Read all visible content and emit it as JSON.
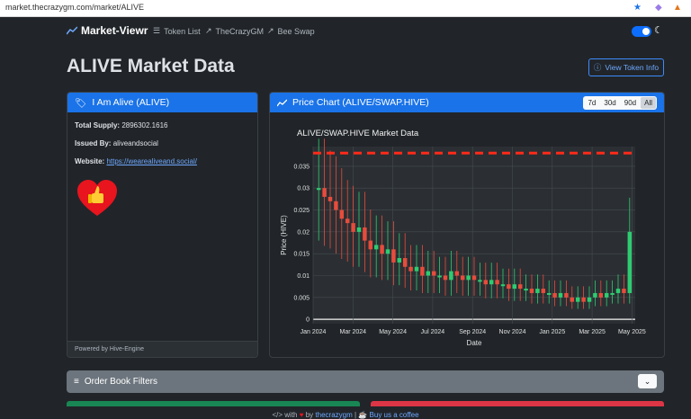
{
  "browser": {
    "url": "market.thecrazygm.com/market/ALIVE"
  },
  "nav": {
    "brand": "Market-Viewr",
    "links": [
      "Token List",
      "TheCrazyGM",
      "Bee Swap"
    ]
  },
  "page": {
    "title": "ALIVE Market Data",
    "view_token_info": "View Token Info"
  },
  "token_card": {
    "header": "I Am Alive (ALIVE)",
    "total_supply_label": "Total Supply:",
    "total_supply": "2896302.1616",
    "issued_by_label": "Issued By:",
    "issued_by": "aliveandsocial",
    "website_label": "Website:",
    "website": "https://wearealiveand.social/",
    "footer": "Powered by Hive-Engine"
  },
  "price_card": {
    "header": "Price Chart (ALIVE/SWAP.HIVE)",
    "ranges": [
      "7d",
      "30d",
      "90d",
      "All"
    ],
    "active_range": "All"
  },
  "chart_data": {
    "type": "line",
    "title": "ALIVE/SWAP.HIVE Market Data",
    "xlabel": "Date",
    "ylabel": "Price (HIVE)",
    "x_ticks": [
      "Jan 2024",
      "Mar 2024",
      "May 2024",
      "Jul 2024",
      "Sep 2024",
      "Nov 2024",
      "Jan 2025",
      "Mar 2025",
      "May 2025"
    ],
    "y_ticks": [
      "0",
      "0.005",
      "0.01",
      "0.015",
      "0.02",
      "0.025",
      "0.03",
      "0.035"
    ],
    "ylim": [
      -0.001,
      0.0395
    ],
    "grid": true,
    "colors": {
      "up": "#2ecc71",
      "down": "#e74c3c",
      "reference": "#ff2a1a"
    },
    "reference_line": 0.038,
    "series": [
      {
        "values": [
          0.03,
          0.028,
          0.027,
          0.025,
          0.023,
          0.022,
          0.02,
          0.021,
          0.018,
          0.016,
          0.017,
          0.015,
          0.016,
          0.013,
          0.014,
          0.012,
          0.011,
          0.012,
          0.01,
          0.011,
          0.01,
          0.01,
          0.009,
          0.011,
          0.01,
          0.009,
          0.01,
          0.009,
          0.009,
          0.008,
          0.009,
          0.008,
          0.008,
          0.007,
          0.008,
          0.007,
          0.007,
          0.006,
          0.007,
          0.006,
          0.006,
          0.005,
          0.006,
          0.005,
          0.004,
          0.005,
          0.004,
          0.005,
          0.006,
          0.005,
          0.006,
          0.006,
          0.007,
          0.006,
          0.02
        ]
      }
    ]
  },
  "filters": {
    "label": "Order Book Filters"
  },
  "footer": {
    "with": "with",
    "by": "by",
    "author": "thecrazygm",
    "sep": "|",
    "coffee": "Buy us a coffee"
  }
}
